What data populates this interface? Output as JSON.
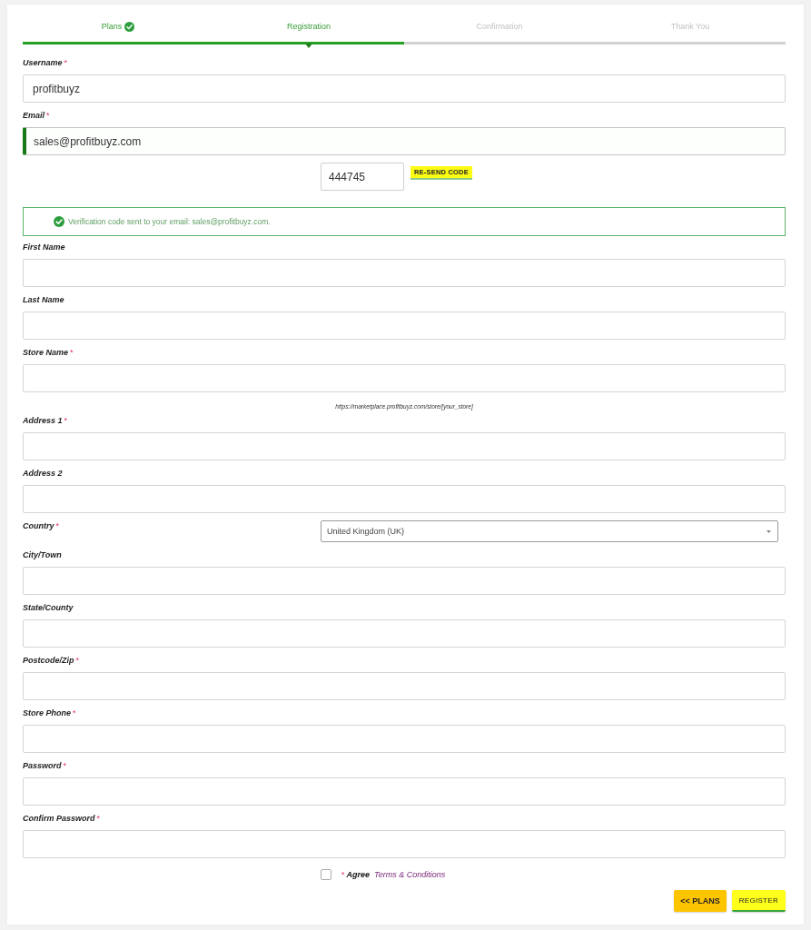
{
  "steps": [
    {
      "label": "Plans",
      "completed": true,
      "selected": false
    },
    {
      "label": "Registration",
      "completed": false,
      "selected": true
    },
    {
      "label": "Confirmation",
      "completed": false,
      "selected": false
    },
    {
      "label": "Thank You",
      "completed": false,
      "selected": false
    }
  ],
  "fields": [
    {
      "kind": "text",
      "label": "Username",
      "required_mark": "*",
      "value": "profitbuyz",
      "focused": false
    },
    {
      "kind": "text",
      "label": "Email",
      "required_mark": "*",
      "value": "sales@profitbuyz.com",
      "focused": true
    },
    {
      "kind": "code",
      "value": "444745",
      "button": "RE-SEND CODE"
    },
    {
      "kind": "alert",
      "message": "Verification code sent to your email: sales@profitbuyz.com."
    },
    {
      "kind": "text",
      "label": "First Name",
      "focused": false
    },
    {
      "kind": "text",
      "label": "Last Name",
      "focused": false
    },
    {
      "kind": "text",
      "label": "Store Name",
      "required_mark": "*",
      "focused": false
    },
    {
      "kind": "hint",
      "text": "https://marketplace.profitbuyz.com/store/[your_store]"
    },
    {
      "kind": "text",
      "label": "Address 1",
      "required_mark": "*",
      "focused": false
    },
    {
      "kind": "text",
      "label": "Address 2",
      "focused": false
    },
    {
      "kind": "select",
      "label": "Country",
      "required_mark": "*",
      "value": "United Kingdom (UK)"
    },
    {
      "kind": "text",
      "label": "City/Town",
      "focused": false
    },
    {
      "kind": "text",
      "label": "State/County",
      "focused": false
    },
    {
      "kind": "text",
      "label": "Postcode/Zip",
      "required_mark": "*",
      "focused": false
    },
    {
      "kind": "text",
      "label": "Store Phone",
      "required_mark": "*",
      "focused": false
    },
    {
      "kind": "text",
      "label": "Password",
      "required_mark": "*",
      "focused": false
    },
    {
      "kind": "text",
      "label": "Confirm Password",
      "required_mark": "*",
      "focused": false
    }
  ],
  "agree": {
    "checked": false,
    "required_mark": "*",
    "label": "Agree",
    "link": "Terms & Conditions"
  },
  "buttons": [
    {
      "kind": "secondary",
      "label": "<< PLANS"
    },
    {
      "kind": "primary",
      "label": "REGISTER"
    }
  ]
}
